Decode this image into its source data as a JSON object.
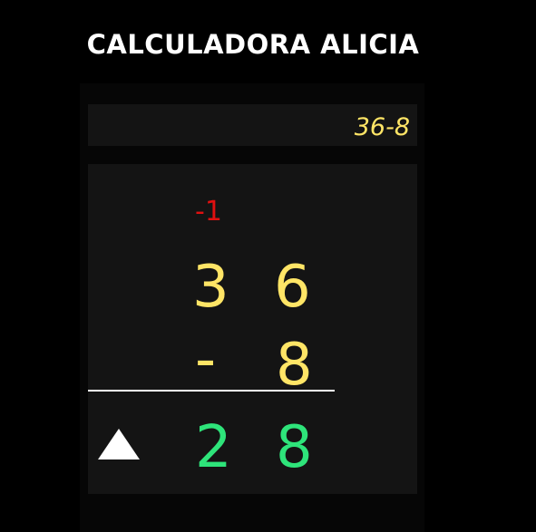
{
  "app": {
    "title": "CALCULADORA ALICIA"
  },
  "display": {
    "expression": "36-8"
  },
  "worksheet": {
    "borrow_mark": "-1",
    "top_tens": "3",
    "top_ones": "6",
    "operator": "-",
    "subtrahend_ones": "8",
    "result_tens": "2",
    "result_ones": "8"
  },
  "colors": {
    "background": "#000000",
    "panel": "#141414",
    "operand_digits": "#ffe566",
    "result_digits": "#2ee47a",
    "borrow_mark": "#e01010",
    "rule": "#ffffff"
  },
  "icons": {
    "toggle": "triangle-up-icon"
  }
}
